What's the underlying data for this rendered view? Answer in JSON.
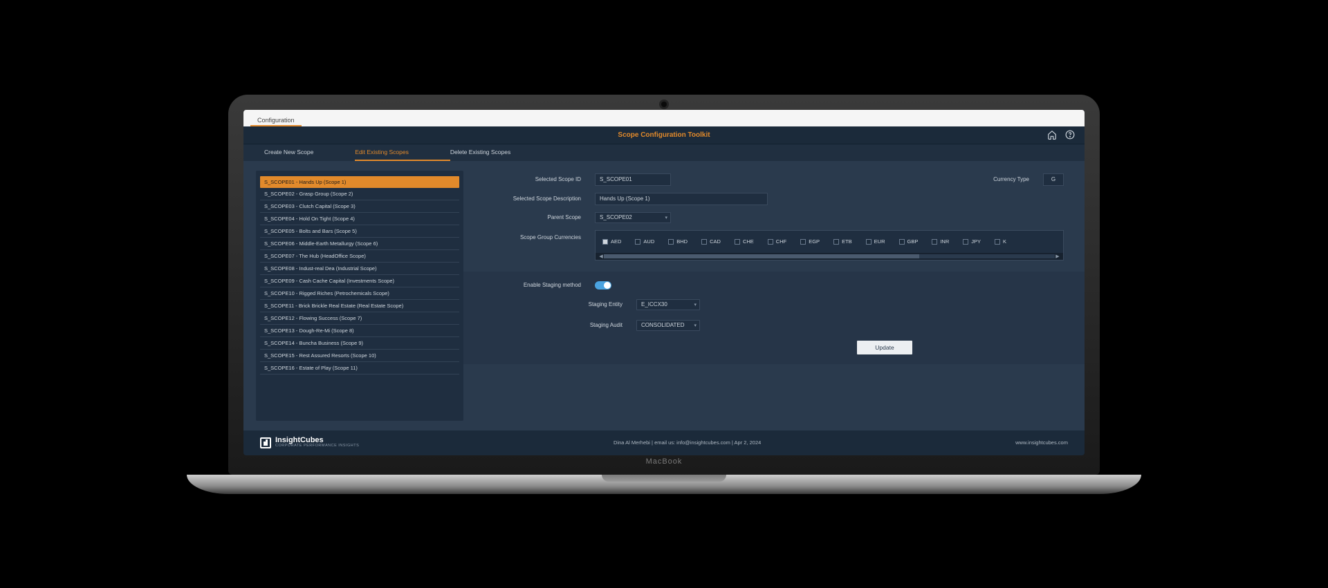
{
  "topTab": "Configuration",
  "pageTitle": "Scope Configuration Toolkit",
  "actions": {
    "create": "Create New Scope",
    "edit": "Edit Existing Scopes",
    "delete": "Delete Existing Scopes"
  },
  "scopes": [
    "S_SCOPE01 - Hands Up (Scope 1)",
    "S_SCOPE02 - Grasp Group (Scope 2)",
    "S_SCOPE03 - Clutch Capital (Scope 3)",
    "S_SCOPE04 - Hold On Tight (Scope 4)",
    "S_SCOPE05 - Bolts and Bars (Scope 5)",
    "S_SCOPE06 - Middle-Earth Metallurgy (Scope 6)",
    "S_SCOPE07 - The Hub (HeadOffice Scope)",
    "S_SCOPE08 - Indust-real Dea (Industrial Scope)",
    "S_SCOPE09 - Cash Cache Capital (Investments Scope)",
    "S_SCOPE10 - Rigged Riches (Petrochemicals Scope)",
    "S_SCOPE11 - Brick Brickle Real Estate (Real Estate Scope)",
    "S_SCOPE12 - Flowing Success (Scope 7)",
    "S_SCOPE13 - Dough-Re-Mi (Scope 8)",
    "S_SCOPE14 - Buncha Business (Scope 9)",
    "S_SCOPE15 - Rest Assured Resorts (Scope 10)",
    "S_SCOPE16 - Estate of Play (Scope 11)"
  ],
  "selectedScopeIndex": 0,
  "form": {
    "labels": {
      "selectedId": "Selected Scope ID",
      "selectedDesc": "Selected Scope Description",
      "parentScope": "Parent Scope",
      "groupCurrencies": "Scope Group Currencies",
      "currencyType": "Currency Type",
      "enableStaging": "Enable Staging method",
      "stagingEntity": "Staging Entity",
      "stagingAudit": "Staging Audit"
    },
    "values": {
      "selectedId": "S_SCOPE01",
      "selectedDesc": "Hands Up (Scope 1)",
      "parentScope": "S_SCOPE02",
      "currencyType": "G",
      "stagingEntity": "E_ICCX30",
      "stagingAudit": "CONSOLIDATED",
      "stagingEnabled": true
    }
  },
  "currencies": [
    {
      "code": "AED",
      "checked": true
    },
    {
      "code": "AUD",
      "checked": false
    },
    {
      "code": "BHD",
      "checked": false
    },
    {
      "code": "CAD",
      "checked": false
    },
    {
      "code": "CHE",
      "checked": false
    },
    {
      "code": "CHF",
      "checked": false
    },
    {
      "code": "EGP",
      "checked": false
    },
    {
      "code": "ETB",
      "checked": false
    },
    {
      "code": "EUR",
      "checked": false
    },
    {
      "code": "GBP",
      "checked": false
    },
    {
      "code": "INR",
      "checked": false
    },
    {
      "code": "JPY",
      "checked": false
    },
    {
      "code": "K",
      "checked": false
    }
  ],
  "updateButton": "Update",
  "footer": {
    "brand": "InsightCubes",
    "tagline": "Corporate Performance Insights",
    "center": "Dina Al Merhebi  |  email us: info@insightcubes.com  |   Apr 2, 2024",
    "right": "www.insightcubes.com"
  },
  "device": "MacBook"
}
